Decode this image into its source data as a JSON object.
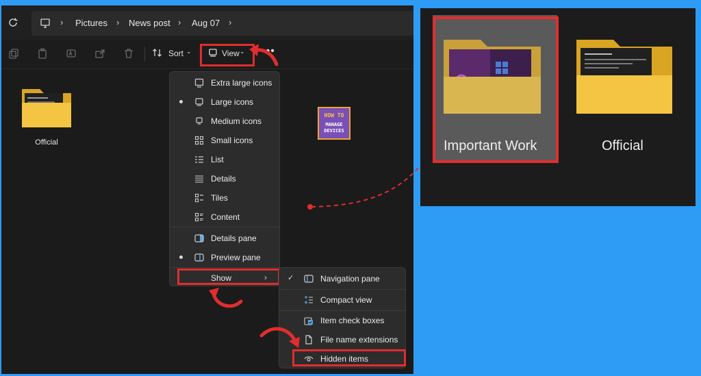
{
  "explorer": {
    "breadcrumb": [
      "Pictures",
      "News post",
      "Aug 07"
    ],
    "toolbar": {
      "sort_label": "Sort",
      "view_label": "View",
      "more_label": "•••"
    },
    "folder": {
      "label": "Official"
    }
  },
  "logo": {
    "line1": "HOW TO",
    "line2": "MANAGE",
    "line3": "DEVICES"
  },
  "view_menu": {
    "items": [
      {
        "label": "Extra large icons",
        "icon": "extra-large-icons-icon",
        "selected": false
      },
      {
        "label": "Large icons",
        "icon": "large-icons-icon",
        "selected": true
      },
      {
        "label": "Medium icons",
        "icon": "medium-icons-icon",
        "selected": false
      },
      {
        "label": "Small icons",
        "icon": "small-icons-icon",
        "selected": false
      },
      {
        "label": "List",
        "icon": "list-icon",
        "selected": false
      },
      {
        "label": "Details",
        "icon": "details-icon",
        "selected": false
      },
      {
        "label": "Tiles",
        "icon": "tiles-icon",
        "selected": false
      },
      {
        "label": "Content",
        "icon": "content-icon",
        "selected": false
      },
      {
        "label": "Details pane",
        "icon": "details-pane-icon",
        "selected": false
      },
      {
        "label": "Preview pane",
        "icon": "preview-pane-icon",
        "selected": true
      },
      {
        "label": "Show",
        "icon": "",
        "selected": false
      }
    ]
  },
  "show_submenu": {
    "items": [
      {
        "label": "Navigation pane",
        "icon": "navigation-pane-icon",
        "checked": true
      },
      {
        "label": "Compact view",
        "icon": "compact-view-icon",
        "checked": false
      },
      {
        "label": "Item check boxes",
        "icon": "item-check-boxes-icon",
        "checked": false
      },
      {
        "label": "File name extensions",
        "icon": "file-icon",
        "checked": false
      },
      {
        "label": "Hidden items",
        "icon": "eye-icon",
        "checked": false
      }
    ]
  },
  "zoom": {
    "folder1_label": "Important Work",
    "folder2_label": "Official"
  },
  "colors": {
    "highlight": "#e12d2d",
    "background": "#2e9bf5",
    "folder": "#f4c542"
  }
}
